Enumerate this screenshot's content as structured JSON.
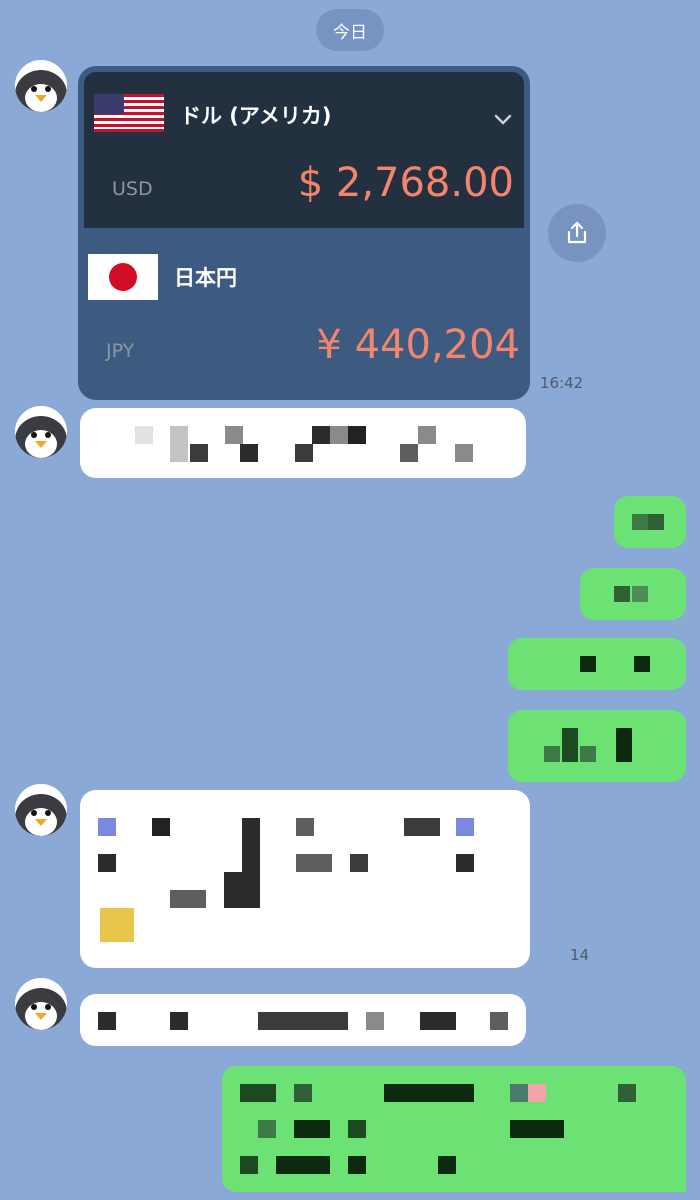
{
  "chat": {
    "date_label": "今日"
  },
  "currency_card": {
    "from": {
      "name": "ドル (アメリカ)",
      "code": "USD",
      "amount": "$ 2,768.00",
      "flag_icon": "us-flag-icon"
    },
    "to": {
      "name": "日本円",
      "code": "JPY",
      "amount": "¥ 440,204",
      "flag_icon": "jp-flag-icon"
    },
    "colors": {
      "top_bg": "#23303f",
      "bottom_bg": "#3d5a80",
      "amount": "#f4846c"
    }
  },
  "messages": {
    "card_time": "16:42",
    "partial_time": "14"
  },
  "colors": {
    "chat_background": "#8ba9d6",
    "outgoing_bubble": "#6be273",
    "incoming_bubble": "#ffffff"
  }
}
